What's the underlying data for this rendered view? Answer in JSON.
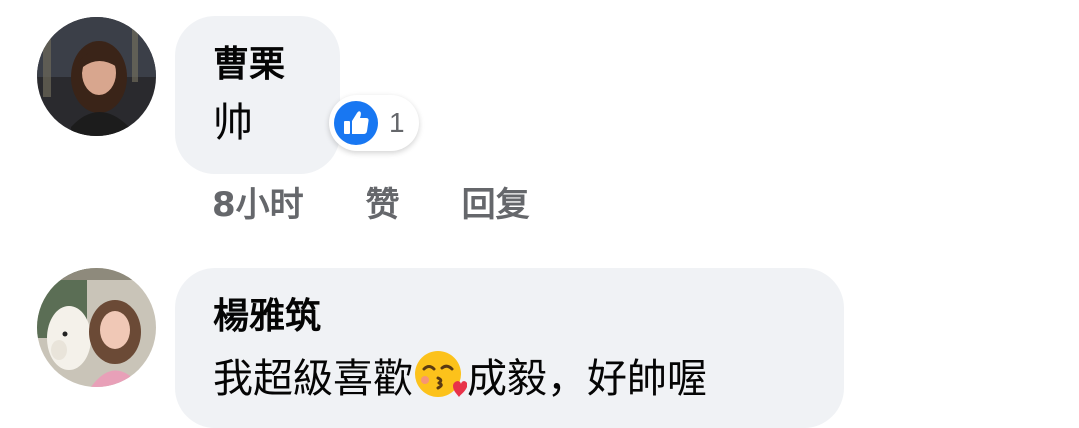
{
  "comments": [
    {
      "author": "曹栗",
      "text": "帅",
      "reaction_icon": "like-icon",
      "reaction_count": "1",
      "time": "8小时",
      "like_label": "赞",
      "reply_label": "回复"
    },
    {
      "author": "楊雅筑",
      "text_before_emoji": "我超級喜歡",
      "emoji": "face-blowing-a-kiss-icon",
      "text_after_emoji": "成毅，好帥喔"
    }
  ],
  "colors": {
    "bubble_bg": "#f0f2f5",
    "like_blue": "#1877f2",
    "meta_gray": "#65676b"
  }
}
